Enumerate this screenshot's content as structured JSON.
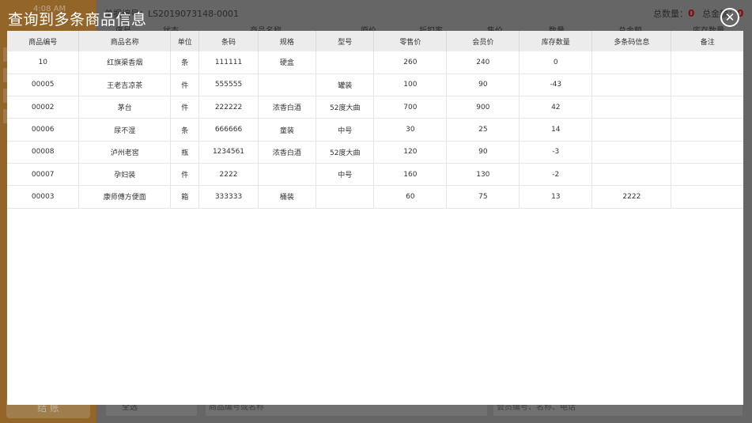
{
  "background": {
    "time": "4:08 AM",
    "order_label": "单据编号：LS2019073148-0001",
    "total_qty_label": "总数量：",
    "total_qty_value": "0",
    "total_amt_label": "总金额：",
    "total_amt_value": "0",
    "columns": [
      "序号",
      "状态",
      "商品名称",
      "原价",
      "折扣率",
      "售价",
      "数量",
      "总金额",
      "库存数量"
    ],
    "settle_label": "结 账",
    "select_all": "全选",
    "search_placeholder": "商品编号或名称",
    "member_placeholder": "会员编号、名称、电话"
  },
  "modal": {
    "title": "查询到多条商品信息",
    "close_glyph": "✕",
    "columns": [
      "商品编号",
      "商品名称",
      "单位",
      "条码",
      "规格",
      "型号",
      "零售价",
      "会员价",
      "库存数量",
      "多条码信息",
      "备注"
    ],
    "rows": [
      [
        "10",
        "红旗渠香烟",
        "条",
        "111111",
        "硬盒",
        "",
        "260",
        "240",
        "0",
        "",
        ""
      ],
      [
        "00005",
        "王老吉凉茶",
        "件",
        "555555",
        "",
        "罐装",
        "100",
        "90",
        "-43",
        "",
        ""
      ],
      [
        "00002",
        "茅台",
        "件",
        "222222",
        "浓香白酒",
        "52度大曲",
        "700",
        "900",
        "42",
        "",
        ""
      ],
      [
        "00006",
        "尿不湿",
        "条",
        "666666",
        "童装",
        "中号",
        "30",
        "25",
        "14",
        "",
        ""
      ],
      [
        "00008",
        "泸州老窖",
        "瓶",
        "1234561",
        "浓香白酒",
        "52度大曲",
        "120",
        "90",
        "-3",
        "",
        ""
      ],
      [
        "00007",
        "孕妇装",
        "件",
        "2222",
        "",
        "中号",
        "160",
        "130",
        "-2",
        "",
        ""
      ],
      [
        "00003",
        "康师傅方便面",
        "箱",
        "333333",
        "桶装",
        "",
        "60",
        "75",
        "13",
        "2222",
        ""
      ]
    ]
  }
}
